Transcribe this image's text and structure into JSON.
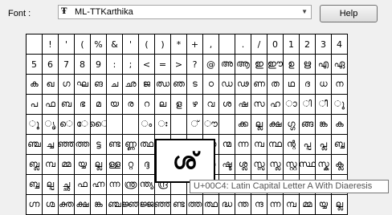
{
  "toolbar": {
    "font_label": "Font :",
    "font_icon": "truetype-icon",
    "font_icon_glyph": "Ŧ",
    "font_value": "ML-TTKarthika",
    "dropdown_glyph": "▼",
    "help_label": "Help"
  },
  "grid": {
    "rows": [
      [
        "",
        "!",
        "'",
        "(",
        "%",
        "&",
        "'",
        "(",
        ")",
        "*",
        "+",
        ",",
        "",
        ".",
        "/",
        "0",
        "1",
        "2",
        "3",
        "4"
      ],
      [
        "5",
        "6",
        "7",
        "8",
        "9",
        ":",
        ";",
        "<",
        "=",
        ">",
        "?",
        "@",
        "അ",
        "ആ",
        "ഇ",
        "ഈ",
        "ഉ",
        "ഋ",
        "എ",
        "ഏ"
      ],
      [
        "ക",
        "ഖ",
        "ഗ",
        "ഘ",
        "ങ",
        "ച",
        "ഛ",
        "ജ",
        "ഝ",
        "ഞ",
        "ട",
        "ഠ",
        "ഡ",
        "ഢ",
        "ണ",
        "ത",
        "ഥ",
        "ദ",
        "ധ",
        "ന"
      ],
      [
        "പ",
        "ഫ",
        "ബ",
        "ഭ",
        "മ",
        "യ",
        "ര",
        "റ",
        "ല",
        "ള",
        "ഴ",
        "വ",
        "ശ",
        "ഷ",
        "സ",
        "ഹ",
        "ാ",
        "ി",
        "ീ",
        "ു"
      ],
      [
        "ൂ",
        "ൃ",
        "െ",
        "േ",
        "ൈ",
        "",
        "",
        "ം",
        "ഃ",
        "",
        "്",
        "ൗ",
        "",
        "ക്ക",
        "ല്ല",
        "ക്ഷ",
        "ഗ്ഗ",
        "ങ്ങ",
        "ങ്ക",
        "ക"
      ],
      [
        "ഞ്ച",
        "ച്ച",
        "ഞ്ഞ",
        "ത്ത",
        "ട്ട",
        "ണ്ട",
        "ണ്ണ",
        "ത്ഥ",
        "ന്ദ",
        "ന്ന",
        "ന്ധ",
        "ന്ത",
        "ന്മ",
        "ന്ന",
        "മ്പ",
        "ന്ഥ",
        "ന്റ",
        "പ്പ",
        "പ്ല",
        "ബ്ബ"
      ],
      [
        "ബ്ല",
        "മ്പ",
        "മ്മ",
        "യ്യ",
        "ല്ല",
        "ള്ള",
        "റ്റ",
        "ദ്ദ",
        "ദ്ധ",
        "ദ്ര",
        "ക്ര",
        "ഗ്ര",
        "ഷ്ട",
        "ശ്ല",
        "സ്സ",
        "സ്ല",
        "സ്റ്റ",
        "സ്ഥ",
        "സ്ക",
        "ക്ല"
      ],
      [
        "ബ്ബ",
        "ല്പ",
        "ച്ഛ",
        "ഫ",
        "ഹ്ന",
        "ന്ന",
        "ന്ത്ര",
        "ന്ത്യ",
        "ന്ദ്ര",
        "",
        "",
        "",
        "",
        "",
        "",
        "",
        "",
        "",
        "",
        ""
      ],
      [
        "ഗ്ന",
        "ഗ്മ",
        "ക്ത",
        "ക്ഷ",
        "ങ്ക",
        "ഞ്ച",
        "ജ്ഞ",
        "ജ്ജ",
        "ഞ്ഞ",
        "ണ്ട",
        "ത്ത",
        "ത്ഥ",
        "ദ്ധ",
        "ന്ത",
        "ന്ദ",
        "ന്ന",
        "മ്പ",
        "മ്മ",
        "യ്യ",
        "ല്ല"
      ]
    ]
  },
  "zoom": {
    "glyph": "ശ്"
  },
  "tooltip": {
    "text": "U+00C4: Latin Capital Letter A With Diaeresis"
  }
}
